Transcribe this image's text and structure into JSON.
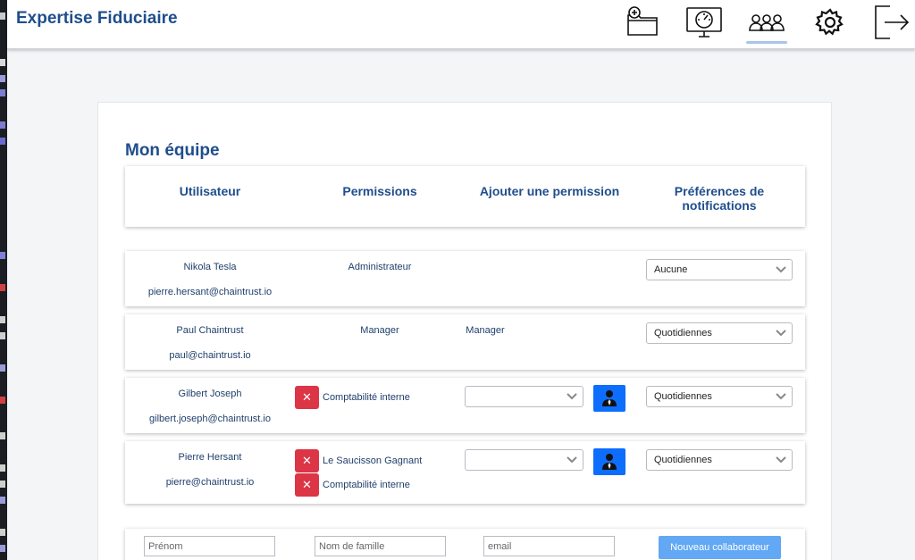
{
  "app": {
    "title": "Expertise Fiduciaire"
  },
  "nav": {
    "icons": [
      "folder-plus-icon",
      "dashboard-monitor-icon",
      "team-icon",
      "gear-icon",
      "logout-icon"
    ],
    "active": "team-icon"
  },
  "page": {
    "title": "Mon équipe"
  },
  "columns": {
    "user": "Utilisateur",
    "permissions": "Permissions",
    "add_permission": "Ajouter une permission",
    "notifications": "Préférences de notifications"
  },
  "members": [
    {
      "name": "Nikola Tesla",
      "email": "pierre.hersant@chaintrust.io",
      "permission": "Administrateur",
      "notification": "Aucune"
    },
    {
      "name": "Paul Chaintrust",
      "email": "paul@chaintrust.io",
      "permission": "Manager",
      "add_permission_text": "Manager",
      "notification": "Quotidiennes"
    },
    {
      "name": "Gilbert Joseph",
      "email": "gilbert.joseph@chaintrust.io",
      "permissions": [
        "Comptabilité interne"
      ],
      "notification": "Quotidiennes"
    },
    {
      "name": "Pierre Hersant",
      "email": "pierre@chaintrust.io",
      "permissions": [
        "Le Saucisson Gagnant",
        "Comptabilité interne"
      ],
      "notification": "Quotidiennes"
    }
  ],
  "new_user": {
    "firstname_placeholder": "Prénom",
    "lastname_placeholder": "Nom de famille",
    "email_placeholder": "email",
    "button": "Nouveau collaborateur"
  },
  "colors": {
    "brand": "#1f4e8c",
    "danger": "#dc3545",
    "primary": "#0d6efd",
    "primary_light": "#62a8f4"
  }
}
